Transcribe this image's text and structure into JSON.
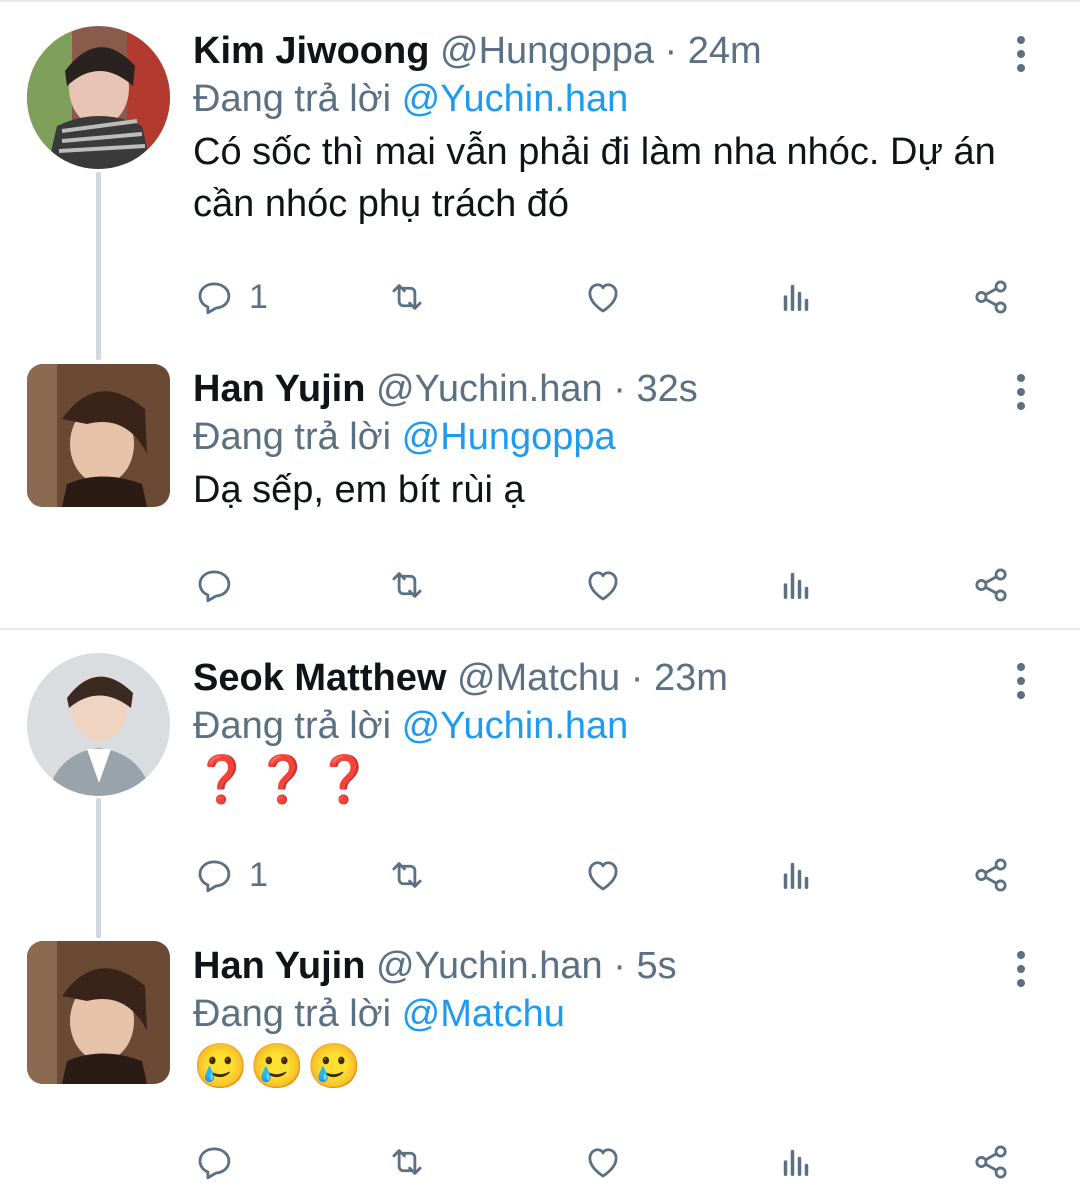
{
  "thread_line_color": "#cfd9de",
  "mention_color": "#1d9bf0",
  "tweets": [
    {
      "name": "Kim Jiwoong",
      "handle": "@Hungoppa",
      "separator": "·",
      "time": "24m",
      "replying_prefix": "Đang trả lời",
      "replying_to": "@Yuchin.han",
      "text": "Có sốc thì mai vẫn phải đi làm nha nhóc. Dự án cần nhóc phụ trách đó",
      "reply_count": "1",
      "actions": [
        "reply-icon",
        "retweet-icon",
        "like-icon",
        "analytics-icon",
        "share-icon"
      ]
    },
    {
      "name": "Han Yujin",
      "handle": "@Yuchin.han",
      "separator": "·",
      "time": "32s",
      "replying_prefix": "Đang trả lời",
      "replying_to": "@Hungoppa",
      "text": "Dạ sếp, em bít rùi ạ",
      "reply_count": "",
      "actions": [
        "reply-icon",
        "retweet-icon",
        "like-icon",
        "analytics-icon",
        "share-icon"
      ]
    },
    {
      "name": "Seok Matthew",
      "handle": "@Matchu",
      "separator": "·",
      "time": "23m",
      "replying_prefix": "Đang trả lời",
      "replying_to": "@Yuchin.han",
      "text": "❓❓❓",
      "reply_count": "1",
      "actions": [
        "reply-icon",
        "retweet-icon",
        "like-icon",
        "analytics-icon",
        "share-icon"
      ]
    },
    {
      "name": "Han Yujin",
      "handle": "@Yuchin.han",
      "separator": "·",
      "time": "5s",
      "replying_prefix": "Đang trả lời",
      "replying_to": "@Matchu",
      "text": "🥲🥲🥲",
      "reply_count": "",
      "actions": [
        "reply-icon",
        "retweet-icon",
        "like-icon",
        "analytics-icon",
        "share-icon"
      ]
    }
  ]
}
